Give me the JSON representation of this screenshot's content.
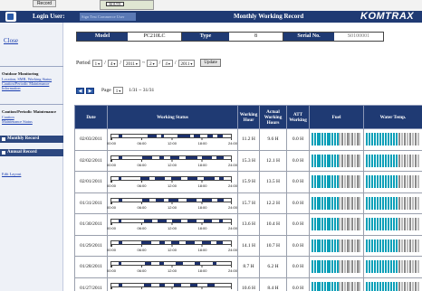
{
  "top_strip": {
    "button_label": "Record",
    "map_label": "ROUTE"
  },
  "header": {
    "login_label": "Login User:",
    "login_user": "Sign Test Commerce User",
    "title": "Monthly Working Record",
    "brand": "KOMTRAX"
  },
  "sidebar": {
    "close_label": "Close",
    "sections": [
      {
        "title": "Outdoor Monitoring",
        "links": [
          "Location, SMR, Working Status",
          "Caution/Periodic Maintenance Information"
        ]
      },
      {
        "head": "Caution/Periodic Maintenance",
        "links": [
          "Caution",
          "Maintenance Status"
        ]
      }
    ],
    "monthly_record": "Monthly Record",
    "annual_record": "Annual Record",
    "edit_layout": "Edit Layout"
  },
  "machine": {
    "model_label": "Model",
    "model_value": "PC210LC",
    "type_label": "Type",
    "type_value": "8",
    "serial_label": "Serial No.",
    "serial_value": "S0100001"
  },
  "period": {
    "label": "Period",
    "from": [
      "1",
      "4",
      "2011"
    ],
    "to": [
      "2",
      "4",
      "2011"
    ],
    "update_label": "Update"
  },
  "pager": {
    "page_label": "Page",
    "page_value": "1",
    "range": "1/31 ~ 31/31"
  },
  "table": {
    "headers": [
      "Date",
      "Working Status",
      "Working Hour",
      "Actual Working Hours",
      "ATT Working",
      "Fuel",
      "Water Temp."
    ],
    "time_labels": [
      "00:00",
      "06:00",
      "12:00",
      "18:00",
      "24:00"
    ],
    "rows": [
      {
        "date": "02/03/2011",
        "working_hour": "11.2 H",
        "actual": "9.6 H",
        "att": "0.0 H",
        "fuel": 0.55,
        "water": 0.6,
        "segments": [
          [
            0.06,
            0.09
          ],
          [
            0.3,
            0.38
          ],
          [
            0.42,
            0.44
          ],
          [
            0.55,
            0.66
          ],
          [
            0.69,
            0.74
          ],
          [
            0.8,
            0.85
          ],
          [
            0.89,
            0.93
          ]
        ]
      },
      {
        "date": "02/02/2011",
        "working_hour": "15.3 H",
        "actual": "12.1 H",
        "att": "0.0 H",
        "fuel": 0.55,
        "water": 0.6,
        "segments": [
          [
            0.06,
            0.09
          ],
          [
            0.26,
            0.34
          ],
          [
            0.4,
            0.44
          ],
          [
            0.49,
            0.57
          ],
          [
            0.62,
            0.72
          ],
          [
            0.76,
            0.84
          ],
          [
            0.88,
            0.94
          ]
        ]
      },
      {
        "date": "02/01/2011",
        "working_hour": "15.9 H",
        "actual": "13.5 H",
        "att": "0.0 H",
        "fuel": 0.55,
        "water": 0.6,
        "segments": [
          [
            0.06,
            0.08
          ],
          [
            0.24,
            0.32
          ],
          [
            0.36,
            0.45
          ],
          [
            0.5,
            0.58
          ],
          [
            0.64,
            0.72
          ],
          [
            0.77,
            0.86
          ],
          [
            0.9,
            0.94
          ]
        ]
      },
      {
        "date": "01/31/2011",
        "working_hour": "15.7 H",
        "actual": "12.2 H",
        "att": "0.0 H",
        "fuel": 0.55,
        "water": 0.6,
        "segments": [
          [
            0.06,
            0.09
          ],
          [
            0.26,
            0.32
          ],
          [
            0.37,
            0.44
          ],
          [
            0.48,
            0.56
          ],
          [
            0.63,
            0.71
          ],
          [
            0.76,
            0.84
          ],
          [
            0.89,
            0.94
          ]
        ]
      },
      {
        "date": "01/30/2011",
        "working_hour": "13.6 H",
        "actual": "10.4 H",
        "att": "0.0 H",
        "fuel": 0.55,
        "water": 0.6,
        "segments": [
          [
            0.06,
            0.08
          ],
          [
            0.27,
            0.34
          ],
          [
            0.39,
            0.46
          ],
          [
            0.51,
            0.58
          ],
          [
            0.64,
            0.71
          ],
          [
            0.77,
            0.84
          ],
          [
            0.9,
            0.93
          ]
        ]
      },
      {
        "date": "01/29/2011",
        "working_hour": "14.1 H",
        "actual": "10.7 H",
        "att": "0.0 H",
        "fuel": 0.55,
        "water": 0.6,
        "segments": [
          [
            0.06,
            0.09
          ],
          [
            0.25,
            0.33
          ],
          [
            0.4,
            0.45
          ],
          [
            0.5,
            0.57
          ],
          [
            0.62,
            0.7
          ],
          [
            0.76,
            0.83
          ],
          [
            0.88,
            0.93
          ]
        ]
      },
      {
        "date": "01/28/2011",
        "working_hour": "8.7 H",
        "actual": "6.2 H",
        "att": "0.0 H",
        "fuel": 0.55,
        "water": 0.6,
        "segments": [
          [
            0.06,
            0.08
          ],
          [
            0.28,
            0.33
          ],
          [
            0.4,
            0.44
          ],
          [
            0.54,
            0.6
          ],
          [
            0.7,
            0.74
          ],
          [
            0.85,
            0.88
          ]
        ]
      },
      {
        "date": "01/27/2011",
        "working_hour": "10.6 H",
        "actual": "8.4 H",
        "att": "0.0 H",
        "fuel": 0.55,
        "water": 0.6,
        "segments": [
          [
            0.06,
            0.09
          ],
          [
            0.27,
            0.33
          ],
          [
            0.4,
            0.45
          ],
          [
            0.52,
            0.58
          ],
          [
            0.66,
            0.72
          ],
          [
            0.8,
            0.86
          ]
        ]
      }
    ]
  },
  "colors": {
    "header_bg": "#1f3a73",
    "bar_fill": "#1c2f6b",
    "gauge_on": "#0aa0b8",
    "gauge_off": "#8a8a8a"
  }
}
